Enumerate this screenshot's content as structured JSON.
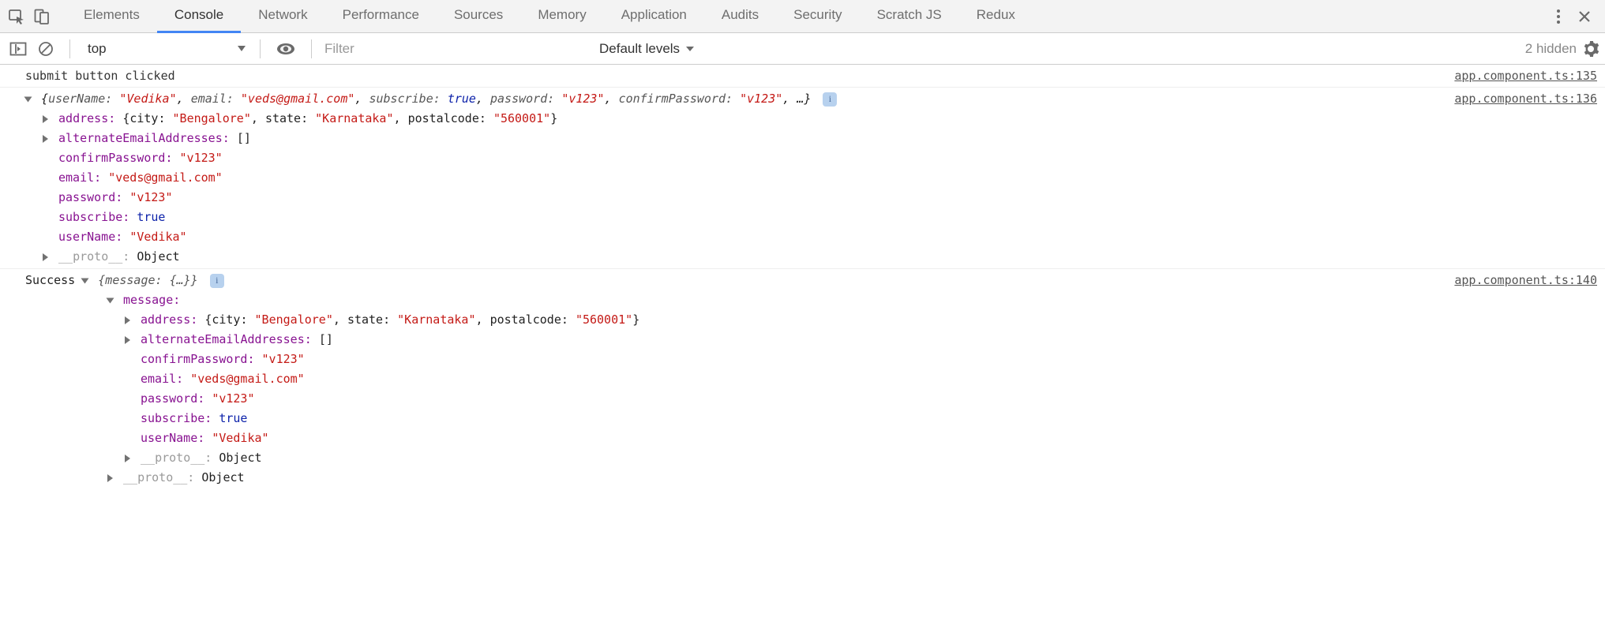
{
  "tabs": {
    "elements": "Elements",
    "console": "Console",
    "network": "Network",
    "performance": "Performance",
    "sources": "Sources",
    "memory": "Memory",
    "application": "Application",
    "audits": "Audits",
    "security": "Security",
    "scratchjs": "Scratch JS",
    "redux": "Redux"
  },
  "toolbar": {
    "context": "top",
    "filter_placeholder": "Filter",
    "levels": "Default levels",
    "hidden": "2 hidden"
  },
  "log1": {
    "text": "submit button clicked",
    "source": "app.component.ts:135"
  },
  "log2": {
    "source": "app.component.ts:136",
    "preview": {
      "prefix": "{",
      "userName_k": "userName: ",
      "userName_v": "\"Vedika\"",
      "email_k": "email: ",
      "email_v": "\"veds@gmail.com\"",
      "subscribe_k": "subscribe: ",
      "subscribe_v": "true",
      "password_k": "password: ",
      "password_v": "\"v123\"",
      "confirmPassword_k": "confirmPassword: ",
      "confirmPassword_v": "\"v123\"",
      "ellipsis": ", …}"
    },
    "expanded": {
      "address_k": "address:",
      "address_city_k": "city: ",
      "address_city_v": "\"Bengalore\"",
      "address_state_k": "state: ",
      "address_state_v": "\"Karnataka\"",
      "address_postal_k": "postalcode: ",
      "address_postal_v": "\"560001\"",
      "altEmails_k": "alternateEmailAddresses:",
      "altEmails_v": "[]",
      "confirmPassword_k": "confirmPassword:",
      "confirmPassword_v": "\"v123\"",
      "email_k": "email:",
      "email_v": "\"veds@gmail.com\"",
      "password_k": "password:",
      "password_v": "\"v123\"",
      "subscribe_k": "subscribe:",
      "subscribe_v": "true",
      "userName_k": "userName:",
      "userName_v": "\"Vedika\"",
      "proto_k": "__proto__:",
      "proto_v": "Object"
    }
  },
  "log3": {
    "source": "app.component.ts:140",
    "success": "Success ",
    "preview": {
      "text": "{message: {…}}"
    },
    "message_k": "message:",
    "expanded": {
      "address_k": "address:",
      "address_city_k": "city: ",
      "address_city_v": "\"Bengalore\"",
      "address_state_k": "state: ",
      "address_state_v": "\"Karnataka\"",
      "address_postal_k": "postalcode: ",
      "address_postal_v": "\"560001\"",
      "altEmails_k": "alternateEmailAddresses:",
      "altEmails_v": "[]",
      "confirmPassword_k": "confirmPassword:",
      "confirmPassword_v": "\"v123\"",
      "email_k": "email:",
      "email_v": "\"veds@gmail.com\"",
      "password_k": "password:",
      "password_v": "\"v123\"",
      "subscribe_k": "subscribe:",
      "subscribe_v": "true",
      "userName_k": "userName:",
      "userName_v": "\"Vedika\"",
      "proto_k": "__proto__:",
      "proto_v": "Object"
    },
    "outer_proto_k": "__proto__:",
    "outer_proto_v": "Object"
  }
}
